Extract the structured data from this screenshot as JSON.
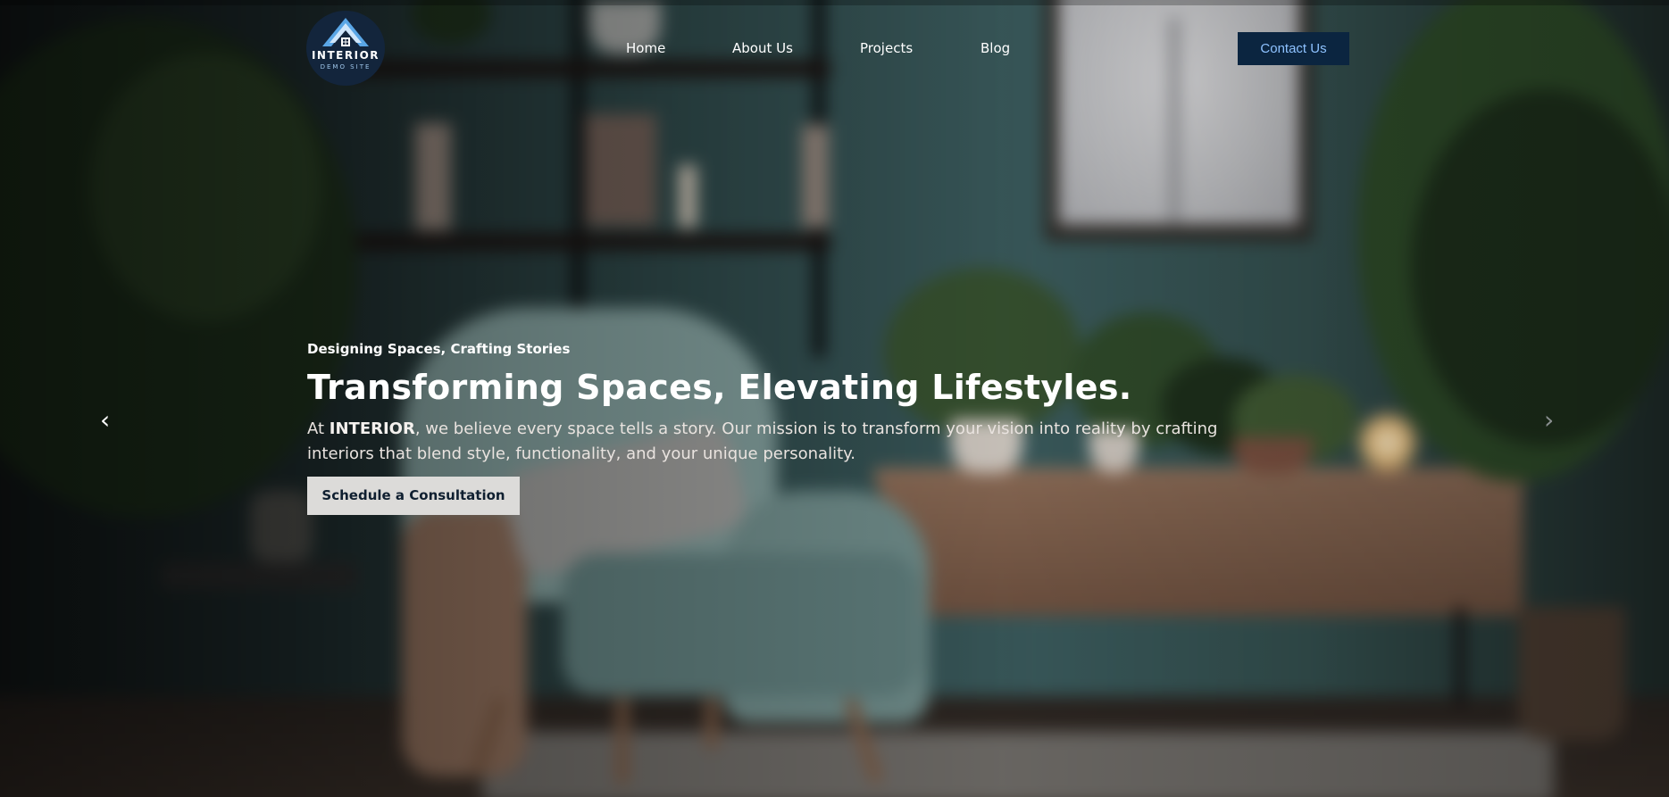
{
  "brand": {
    "name": "INTERIOR",
    "tagline": "DEMO SITE"
  },
  "nav": {
    "items": [
      {
        "label": "Home"
      },
      {
        "label": "About Us"
      },
      {
        "label": "Projects"
      },
      {
        "label": "Blog"
      }
    ],
    "cta_label": "Contact Us"
  },
  "hero": {
    "eyebrow": "Designing Spaces, Crafting Stories",
    "headline": "Transforming Spaces, Elevating Lifestyles.",
    "body_prefix": "At ",
    "body_brand": "INTERIOR",
    "body_rest": ", we believe every space tells a story. Our mission is to transform your vision into reality by crafting interiors that blend style, functionality, and your unique personality.",
    "button_label": "Schedule a Consultation",
    "prev_arrow": "‹",
    "next_arrow": "›"
  },
  "colors": {
    "cta_bg": "#0b2540",
    "cta_text": "#8ec2ff",
    "button_bg": "#dcdbd9",
    "button_text": "#0f1f30",
    "logo_bg": "#13253c"
  },
  "icons": {
    "logo": "house-roof-logo-icon",
    "prev": "chevron-left-icon",
    "next": "chevron-right-icon"
  }
}
